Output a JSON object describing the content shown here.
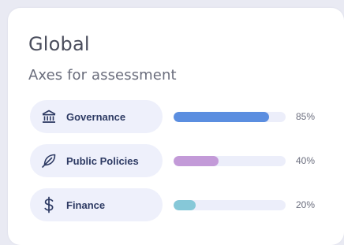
{
  "card": {
    "title": "Global",
    "subtitle": "Axes for assessment"
  },
  "axes": [
    {
      "label": "Governance",
      "icon": "bank-icon",
      "percent_text": "85%",
      "value": 0.85,
      "color": "#5b8ee0"
    },
    {
      "label": "Public Policies",
      "icon": "feather-icon",
      "percent_text": "40%",
      "value": 0.4,
      "color": "#c39ad8"
    },
    {
      "label": "Finance",
      "icon": "dollar-icon",
      "percent_text": "20%",
      "value": 0.2,
      "color": "#86c8d8"
    }
  ]
}
